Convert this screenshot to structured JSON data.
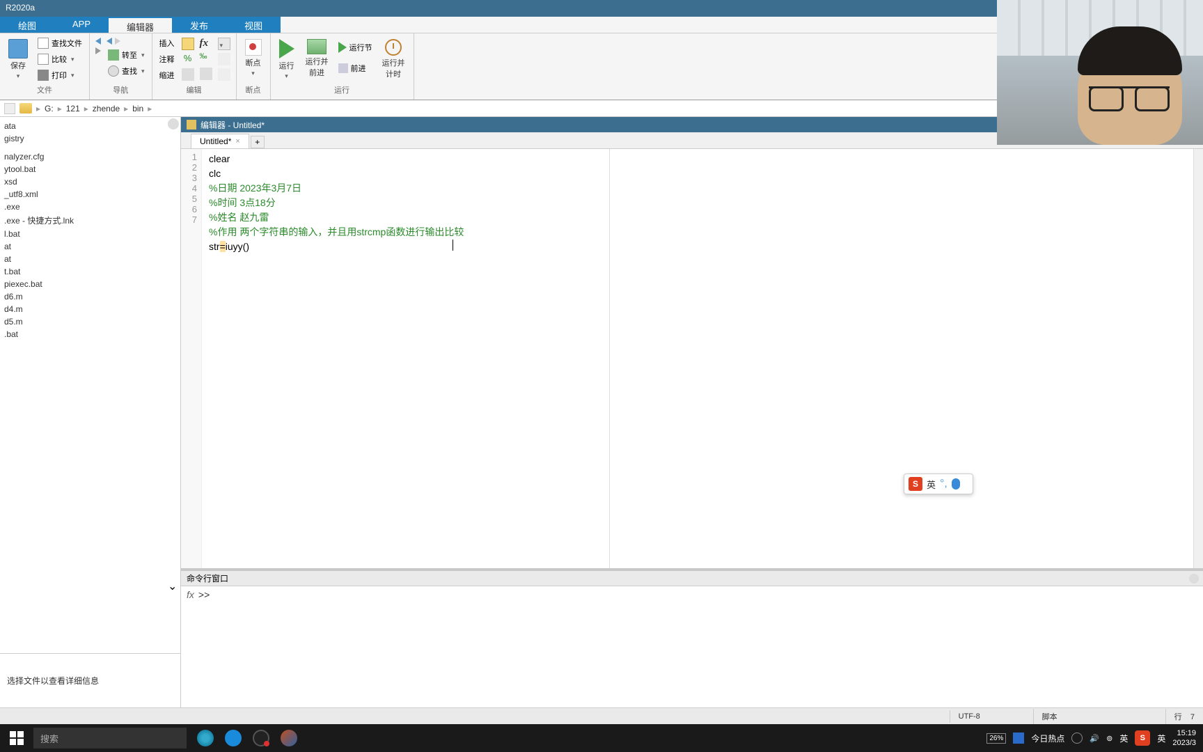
{
  "title_bar": "R2020a",
  "tabs": {
    "plot": "绘图",
    "app": "APP",
    "editor": "编辑器",
    "publish": "发布",
    "view": "视图"
  },
  "ribbon": {
    "file": {
      "save": "保存",
      "find_file": "查找文件",
      "compare": "比较",
      "print": "打印",
      "label": "文件"
    },
    "nav": {
      "goto": "转至",
      "find": "查找",
      "label": "导航"
    },
    "edit": {
      "insert": "插入",
      "comment": "注释",
      "indent": "缩进",
      "fx": "fx",
      "label": "编辑"
    },
    "breakpoint": {
      "label_btn": "断点",
      "label": "断点"
    },
    "run": {
      "run": "运行",
      "run_adv": "运行并\n前进",
      "run_section": "运行节",
      "advance": "前进",
      "run_time": "运行并\n计时",
      "label": "运行"
    }
  },
  "breadcrumb": {
    "drive": "G:",
    "p1": "121",
    "p2": "zhende",
    "p3": "bin"
  },
  "sidebar": {
    "files": [
      "ata",
      "gistry",
      "",
      "",
      "nalyzer.cfg",
      "ytool.bat",
      "xsd",
      "_utf8.xml",
      ".exe",
      ".exe - 快捷方式.lnk",
      "l.bat",
      "at",
      "at",
      "t.bat",
      "piexec.bat",
      "d6.m",
      "d4.m",
      "d5.m",
      ".bat"
    ],
    "footer": "选择文件以查看详细信息"
  },
  "editor": {
    "header": "编辑器 - Untitled*",
    "tab": "Untitled*",
    "lines": {
      "l1": "clear",
      "l2": "clc",
      "l3": "%日期 2023年3月7日",
      "l4": "%时间 3点18分",
      "l5": "%姓名 赵九雷",
      "l6": "%作用  两个字符串的输入，并且用strcmp函数进行输出比较",
      "l7a": "str",
      "l7b": "=",
      "l7c": "iuyy",
      "l7d": "()"
    }
  },
  "cmd": {
    "title": "命令行窗口",
    "fx": "fx",
    "prompt": ">>"
  },
  "status": {
    "encoding": "UTF-8",
    "type": "脚本",
    "line_label": "行",
    "line": "7"
  },
  "taskbar": {
    "search_placeholder": "搜索",
    "hot": "今日热点",
    "battery": "26%",
    "lang1": "英",
    "lang2": "英",
    "time": "15:19",
    "date": "2023/3"
  },
  "ime": {
    "lang": "英",
    "logo": "S"
  }
}
